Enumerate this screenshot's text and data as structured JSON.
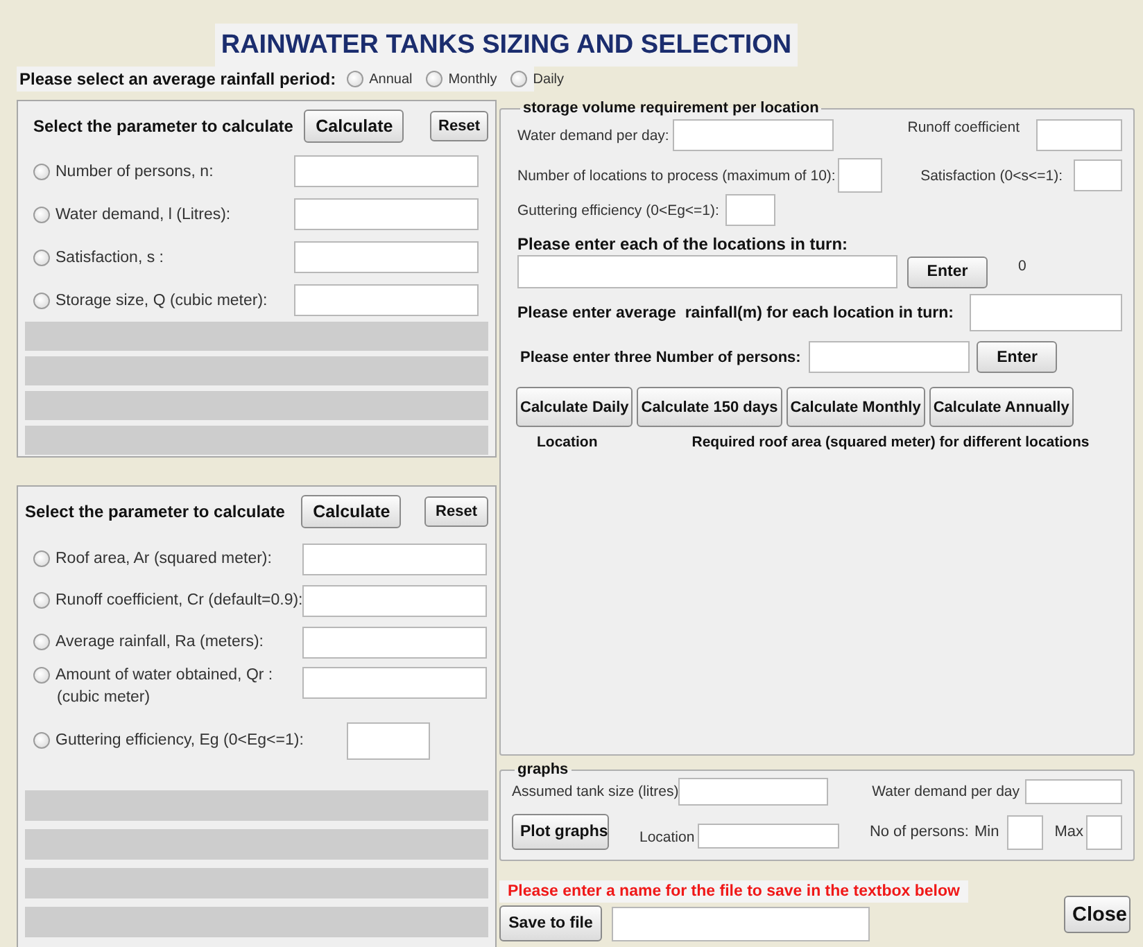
{
  "title": "RAINWATER TANKS SIZING AND SELECTION",
  "rainfall_period": {
    "label": "Please select an average rainfall period:",
    "options": [
      {
        "label": "Annual",
        "selected": false
      },
      {
        "label": "Monthly",
        "selected": false
      },
      {
        "label": "Daily",
        "selected": false
      }
    ]
  },
  "calc_panels": [
    {
      "heading": "Select the parameter to calculate",
      "calculate_button": "Calculate",
      "reset_button": "Reset",
      "parameters": [
        {
          "label": "Number of persons, n:",
          "selected": false,
          "kind": "wide"
        },
        {
          "label": "Water demand, l (Litres):",
          "selected": false,
          "kind": "wide"
        },
        {
          "label": "Satisfaction, s :",
          "selected": false,
          "kind": "wide"
        },
        {
          "label": "Storage size, Q (cubic meter):",
          "selected": false,
          "kind": "wide"
        }
      ]
    },
    {
      "heading": "Select the parameter to calculate",
      "calculate_button": "Calculate",
      "reset_button": "Reset",
      "parameters": [
        {
          "label": "Roof area, Ar (squared meter):",
          "selected": false,
          "kind": "wide"
        },
        {
          "label": "Runoff coefficient, Cr (default=0.9):",
          "selected": false,
          "kind": "wide"
        },
        {
          "label": "Average rainfall, Ra (meters):",
          "selected": false,
          "kind": "wide"
        },
        {
          "label": "Amount of water obtained, Qr :",
          "note": "(cubic meter)",
          "selected": false,
          "kind": "wide"
        },
        {
          "label": "Guttering efficiency, Eg (0<Eg<=1):",
          "selected": false,
          "kind": "short"
        }
      ]
    }
  ],
  "storage": {
    "legend": "storage volume requirement per location",
    "water_demand_label": "Water demand per day:",
    "runoff_label": "Runoff coefficient",
    "locations_count_label": "Number of locations to process (maximum of 10):",
    "satisfaction_label": "Satisfaction (0<s<=1):",
    "guttering_label": "Guttering efficiency (0<Eg<=1):",
    "locations_prompt": "Please enter each of the locations in turn:",
    "enter_button": "Enter",
    "location_counter": "0",
    "rainfall_prompt": "Please enter average  rainfall(m) for each location in turn:",
    "persons_prompt": "Please enter three Number of persons:",
    "persons_enter_button": "Enter",
    "calculate_buttons": [
      "Calculate Daily",
      "Calculate 150 days",
      "Calculate Monthly",
      "Calculate Annually"
    ],
    "result_headers": [
      "Location",
      "Required roof area (squared meter) for different locations"
    ]
  },
  "graphs": {
    "legend": "graphs",
    "tank_size_label": "Assumed tank size (litres)",
    "water_demand_label": "Water demand per day",
    "plot_button": "Plot graphs",
    "location_label": "Location",
    "persons_label": "No of persons:",
    "min_label": "Min",
    "max_label": "Max"
  },
  "save": {
    "prompt": "Please enter a name for the file to save in the textbox below",
    "button": "Save to file"
  },
  "close_button": "Close"
}
